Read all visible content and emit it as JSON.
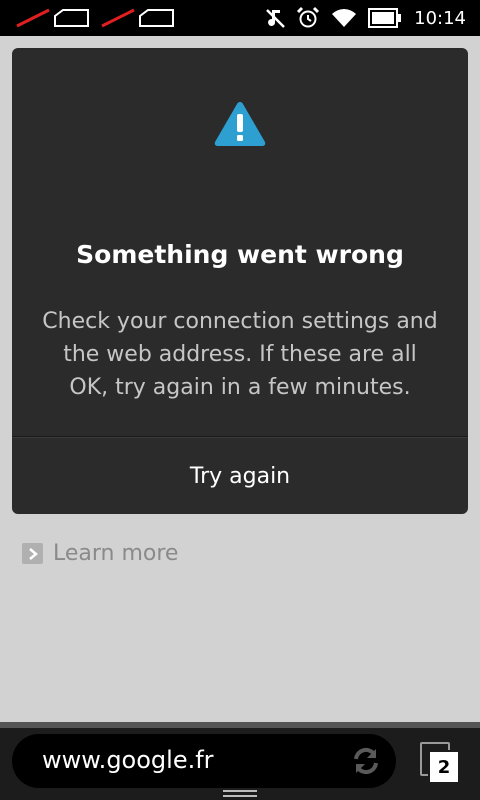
{
  "status_bar": {
    "time": "10:14",
    "icons": [
      "sim1-no-signal-icon",
      "sim2-no-signal-icon",
      "mute-icon",
      "alarm-icon",
      "wifi-icon",
      "battery-icon"
    ]
  },
  "error_card": {
    "icon": "warning-icon",
    "title": "Something went wrong",
    "message": "Check your connection settings and the web address. If these are all OK, try again in a few minutes.",
    "retry_label": "Try again"
  },
  "learn_more": {
    "icon": "chevron-right-icon",
    "label": "Learn more"
  },
  "bottom_bar": {
    "url": "www.google.fr",
    "refresh_icon": "refresh-icon",
    "tab_count": "2"
  },
  "colors": {
    "accent": "#2d9fd1",
    "card_bg": "#2b2b2b",
    "page_bg": "#d2d2d2"
  }
}
